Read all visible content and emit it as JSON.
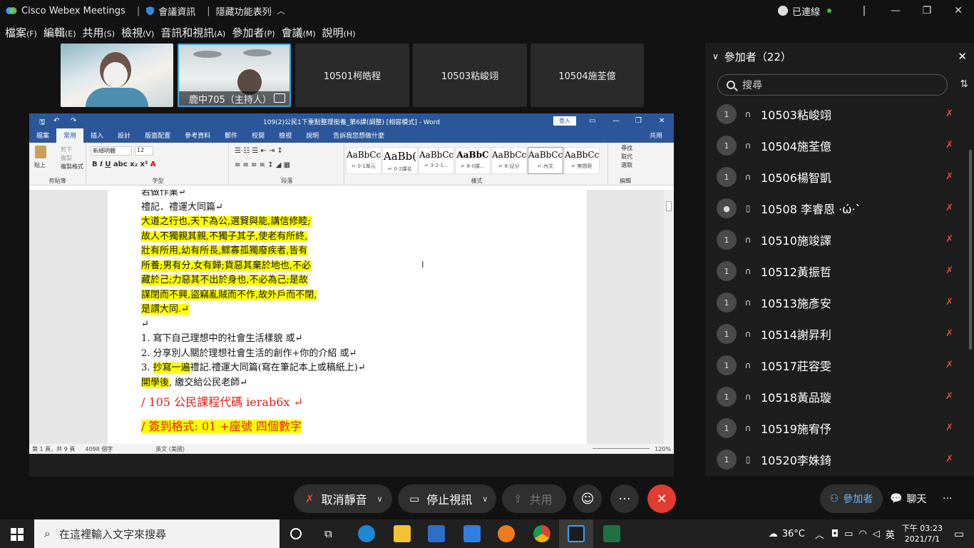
{
  "titlebar": {
    "app_name": "Cisco Webex Meetings",
    "meeting_info": "會議資訊",
    "hide_menu": "隱藏功能表列",
    "connection": "已連線"
  },
  "menubar": [
    {
      "label": "檔案",
      "key": "(F)"
    },
    {
      "label": "編輯",
      "key": "(E)"
    },
    {
      "label": "共用",
      "key": "(S)"
    },
    {
      "label": "檢視",
      "key": "(V)"
    },
    {
      "label": "音訊和視訊",
      "key": "(A)"
    },
    {
      "label": "參加者",
      "key": "(P)"
    },
    {
      "label": "會議",
      "key": "(M)"
    },
    {
      "label": "說明",
      "key": "(H)"
    }
  ],
  "videos": {
    "host_label": "鹿中705（主持人）",
    "tiles": [
      "10501柯皓程",
      "10503粘峻翊",
      "10504施荃億"
    ]
  },
  "word": {
    "title": "109(2)公民1下重點整理銜養_第6課(調整) [相容模式] - Word",
    "login": "登入",
    "tabs": [
      "檔案",
      "常用",
      "插入",
      "設計",
      "版面配置",
      "參考資料",
      "郵件",
      "校閱",
      "檢視",
      "說明",
      "告訴我您想做什麼"
    ],
    "share": "共用",
    "font_name": "新細明體",
    "font_size": "12",
    "clipboard": {
      "paste": "貼上",
      "cut": "剪下",
      "copy": "複製",
      "format_painter": "複製格式"
    },
    "groups": {
      "clipboard": "剪貼簿",
      "font": "字型",
      "paragraph": "段落",
      "styles": "樣式",
      "editing": "編輯"
    },
    "styles": [
      {
        "sample": "AaBbCc",
        "name": "↵ 0-1單元"
      },
      {
        "sample": "AaBb(",
        "name": "↵ 0-2課名"
      },
      {
        "sample": "AaBbCcI",
        "name": "↵ 3-2-1..."
      },
      {
        "sample": "AaBbC",
        "name": "↵ 8-0課..."
      },
      {
        "sample": "AaBbCcI",
        "name": "↵ 8-記分"
      },
      {
        "sample": "AaBbCcI",
        "name": "↵ 內文"
      },
      {
        "sample": "AaBbCcI",
        "name": "↵ 無間距"
      }
    ],
    "editing": {
      "find": "尋找",
      "replace": "取代",
      "select": "選取"
    },
    "doc_lines": [
      {
        "text": "若做作業↵",
        "hl": false
      },
      {
        "text": "禮記．禮運大同篇↵",
        "hl": false
      },
      {
        "text": "大道之行也,天下為公,選賢與能,講信修睦;",
        "hl": true
      },
      {
        "text": "故人不獨親其親,不獨子其子,使老有所終,",
        "hl": true
      },
      {
        "text": "壯有所用,幼有所長,鰥寡孤獨廢疾者,皆有",
        "hl": true
      },
      {
        "text": "所養;男有分,女有歸;貨惡其棄於地也,不必",
        "hl": true
      },
      {
        "text": "藏於己;力惡其不出於身也,不必為己;是故",
        "hl": true
      },
      {
        "text": "謀閉而不興,盜竊亂賊而不作,故外戶而不閉,",
        "hl": true
      },
      {
        "text": "是謂大同.↵",
        "hl": true
      },
      {
        "text": "↵",
        "hl": false
      },
      {
        "text": "1. 寫下自己理想中的社會生活樣貌    或↵",
        "hl": false
      },
      {
        "text": "2. 分享別人關於理想社會生活的創作+你的介紹    或↵",
        "hl": false
      }
    ],
    "line3_hl": "抄寫一遍",
    "line3_rest": "禮記.禮運大同篇(寫在筆記本上或稿紙上)↵",
    "line4_hl": "開學後",
    "line4_rest": ", 繳交給公民老師↵",
    "red1": "/ 105  公民課程代碼        ierab6x      ↵",
    "red2": "/  簽到格式:   01 +座號     四個數字",
    "status": {
      "page": "第 1 頁，共 9 頁",
      "words": "4098 個字",
      "lang": "英文 (美國)",
      "zoom": "120%"
    }
  },
  "participants": {
    "title": "參加者（22）",
    "search_placeholder": "搜尋",
    "list": [
      {
        "name": "10503粘峻翊",
        "badge": "1",
        "device": "headset"
      },
      {
        "name": "10504施荃億",
        "badge": "1",
        "device": "headset"
      },
      {
        "name": "10506楊智凱",
        "badge": "1",
        "device": "headset"
      },
      {
        "name": "10508 李睿恩 ·ώ·`",
        "badge": "",
        "device": "phone"
      },
      {
        "name": "10510施竣譯",
        "badge": "1",
        "device": "headset"
      },
      {
        "name": "10512黃振哲",
        "badge": "1",
        "device": "headset"
      },
      {
        "name": "10513施彥安",
        "badge": "1",
        "device": "headset"
      },
      {
        "name": "10514謝昇利",
        "badge": "1",
        "device": "headset"
      },
      {
        "name": "10517莊容雯",
        "badge": "1",
        "device": "headset"
      },
      {
        "name": "10518黃品璇",
        "badge": "1",
        "device": "headset"
      },
      {
        "name": "10519施宥伃",
        "badge": "1",
        "device": "headset"
      },
      {
        "name": "10520李姝錡",
        "badge": "1",
        "device": "phone"
      }
    ]
  },
  "controls": {
    "unmute": "取消靜音",
    "stop_video": "停止視訊",
    "share": "共用",
    "participants": "參加者",
    "chat": "聊天"
  },
  "taskbar": {
    "search_placeholder": "在這裡輸入文字來搜尋",
    "weather": "36°C",
    "ime": "英",
    "time": "下午 03:23",
    "date": "2021/7/1"
  }
}
